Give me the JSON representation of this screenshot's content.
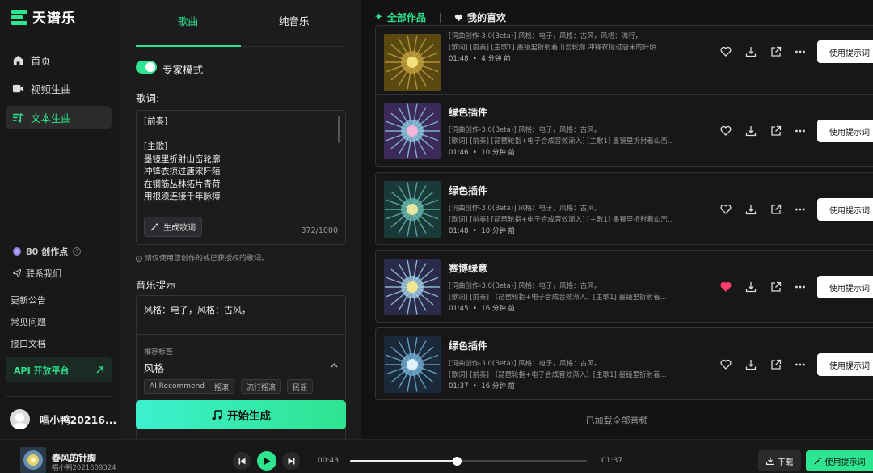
{
  "app": {
    "name": "天谱乐"
  },
  "sidebar": {
    "nav": [
      {
        "label": "首页",
        "icon": "home-icon"
      },
      {
        "label": "视频生曲",
        "icon": "video-icon"
      },
      {
        "label": "文本生曲",
        "icon": "text-music-icon",
        "active": true
      }
    ],
    "credits": "80 创作点",
    "contact": "联系我们",
    "links": [
      "更新公告",
      "常见问题",
      "接口文档"
    ],
    "api_label": "API 开放平台",
    "user_name": "唱小鸭20216..."
  },
  "composer": {
    "tabs": [
      "歌曲",
      "纯音乐"
    ],
    "active_tab": 0,
    "expert_mode_label": "专家模式",
    "expert_mode_on": true,
    "lyrics_label": "歌词:",
    "lyrics_text": "[前奏]\n\n[主歌]\n墨镜里折射山峦轮廓\n冲锋衣掠过唐宋阡陌\n在钢筋丛林拓片青荷\n用根须连接千年脉搏",
    "gen_lyrics_button": "生成歌词",
    "lyrics_count": "372/1000",
    "lyrics_hint": "请仅使用您创作的或已获授权的歌词。",
    "music_prompt_label": "音乐提示",
    "music_prompt_text": "风格：电子，风格：古风，",
    "recommended_tags_label": "推荐标签",
    "style_label": "风格",
    "style_tags": [
      "AI Recommend",
      "摇滚",
      "流行摇滚",
      "民谣"
    ],
    "start_button": "开始生成"
  },
  "works": {
    "tabs": [
      "全部作品",
      "我的喜欢"
    ],
    "use_prompt_label": "使用提示词",
    "cards": [
      {
        "title": "",
        "line1": "[词曲创作-3.0(Beta)] 风格：电子，风格：古风，风格：流行，",
        "line2": "[歌词] [前奏] [主歌1] 墨镜里折射着山峦轮廓 冲锋衣掠过唐宋的阡陌 ...",
        "duration": "01:48",
        "ago": "4 分钟 前",
        "liked": false
      },
      {
        "title": "绿色插件",
        "line1": "[词曲创作-3.0(Beta)] 风格：电子，风格：古风，",
        "line2": "[歌词] [前奏] [琵琶轮指+电子合成音效渐入] [主歌1] 墨镜里折射着山峦...",
        "duration": "01:46",
        "ago": "10 分钟 前",
        "liked": false
      },
      {
        "title": "绿色插件",
        "line1": "[词曲创作-3.0(Beta)] 风格：电子，风格：古风，",
        "line2": "[歌词] [前奏] [琵琶轮指+电子合成音效渐入] [主歌1] 墨镜里折射着山峦...",
        "duration": "01:48",
        "ago": "10 分钟 前",
        "liked": false
      },
      {
        "title": "赛博绿意",
        "line1": "[词曲创作-3.0(Beta)] 风格：电子，风格：古风，",
        "line2": "[歌词] [前奏] （琵琶轮指+电子合成音效渐入）[主歌1] 墨镜里折射着...",
        "duration": "01:45",
        "ago": "16 分钟 前",
        "liked": true
      },
      {
        "title": "绿色插件",
        "line1": "[词曲创作-3.0(Beta)] 风格：电子，风格：古风，",
        "line2": "[歌词] [前奏] （琵琶轮指+电子合成音效渐入）[主歌1] 墨镜里折射着...",
        "duration": "01:37",
        "ago": "16 分钟 前",
        "liked": false
      }
    ],
    "all_loaded": "已加载全部音频"
  },
  "player": {
    "title": "春风的针脚",
    "artist": "唱小鸭2021609324",
    "current_time": "00:43",
    "total_time": "01:37",
    "progress": 0.45,
    "download_label": "下载",
    "use_prompt_label": "使用提示词"
  },
  "colors": {
    "accent": "#2de58f",
    "like": "#ff3e6c"
  }
}
